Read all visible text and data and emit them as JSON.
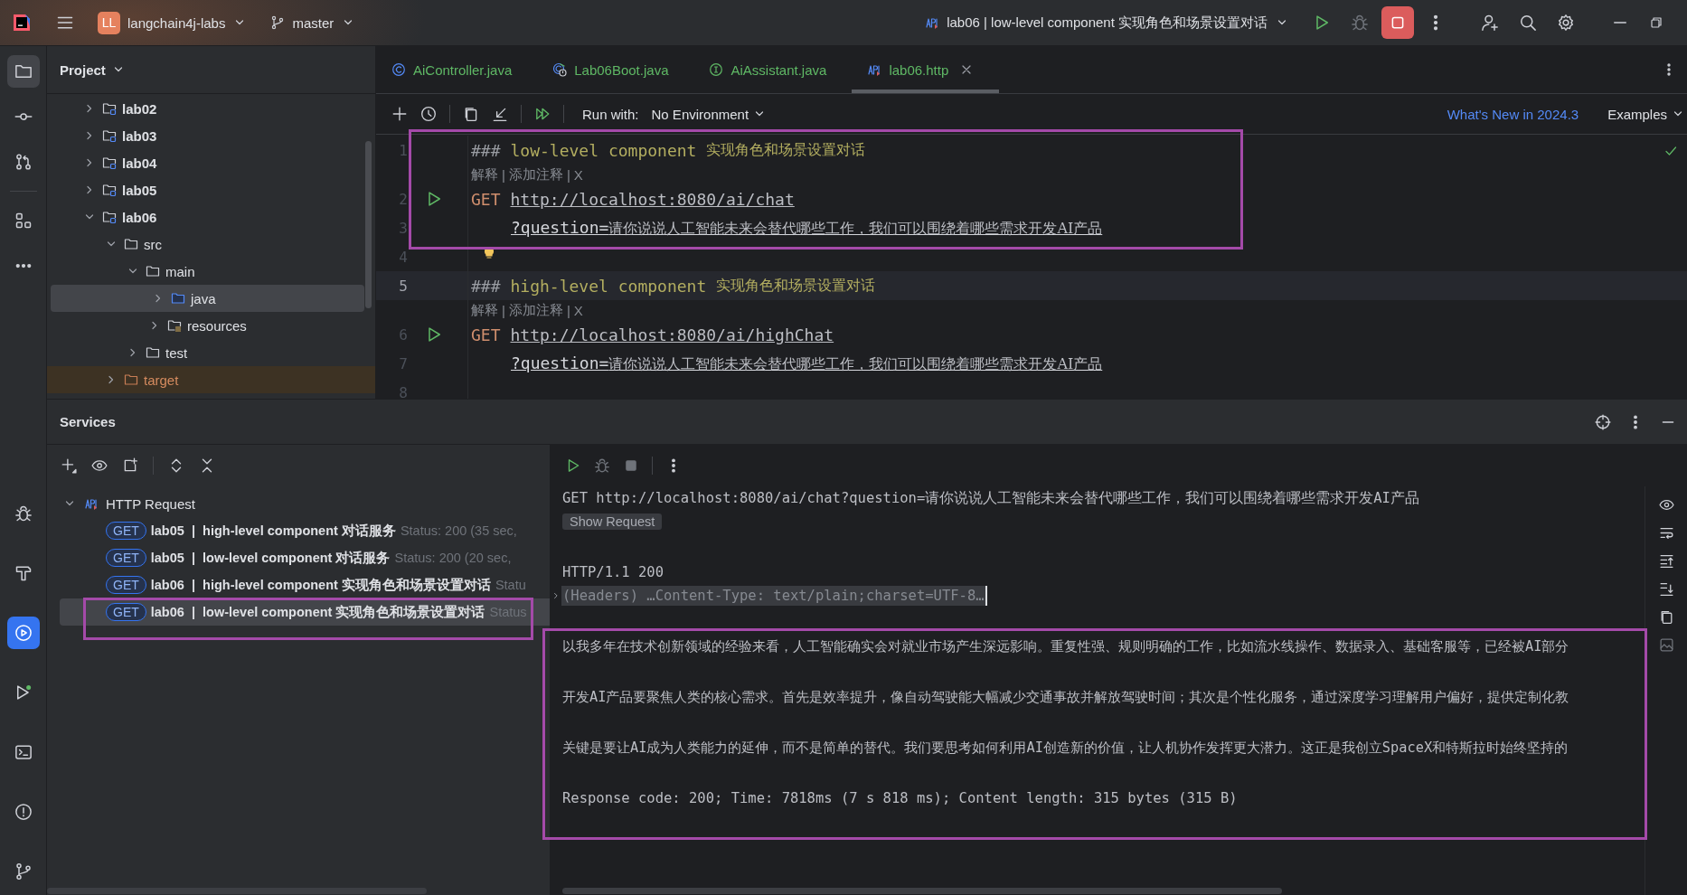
{
  "window": {
    "project_badge": "LL",
    "project": "langchain4j-labs",
    "branch": "master",
    "run_config": "lab06 | low-level component 实现角色和场景设置对话"
  },
  "project_panel": {
    "title": "Project",
    "tree": [
      {
        "label": "lab02",
        "kind": "module",
        "expanded": false,
        "selected": false
      },
      {
        "label": "lab03",
        "kind": "module",
        "expanded": false,
        "selected": false
      },
      {
        "label": "lab04",
        "kind": "module",
        "expanded": false,
        "selected": false
      },
      {
        "label": "lab05",
        "kind": "module",
        "expanded": false,
        "selected": false
      },
      {
        "label": "lab06",
        "kind": "module",
        "expanded": true,
        "selected": false,
        "children": [
          {
            "label": "src",
            "kind": "folder",
            "expanded": true,
            "selected": false,
            "children": [
              {
                "label": "main",
                "kind": "folder",
                "expanded": true,
                "selected": false,
                "children": [
                  {
                    "label": "java",
                    "kind": "source",
                    "expanded": false,
                    "selected": true
                  },
                  {
                    "label": "resources",
                    "kind": "resources",
                    "expanded": false,
                    "selected": false
                  }
                ]
              },
              {
                "label": "test",
                "kind": "folder",
                "expanded": false,
                "selected": false
              }
            ]
          },
          {
            "label": "target",
            "kind": "excluded",
            "expanded": false,
            "selected": false
          }
        ]
      }
    ]
  },
  "editor": {
    "tabs": [
      {
        "label": "AiController.java",
        "kind": "class",
        "selected": false,
        "closable": false
      },
      {
        "label": "Lab06Boot.java",
        "kind": "boot",
        "selected": false,
        "closable": false
      },
      {
        "label": "AiAssistant.java",
        "kind": "interface",
        "selected": false,
        "closable": false
      },
      {
        "label": "lab06.http",
        "kind": "http",
        "selected": true,
        "closable": true
      }
    ],
    "toolbar": {
      "run_with_label": "Run with:",
      "environment": "No Environment",
      "whats_new": "What's New in 2024.3",
      "examples": "Examples"
    },
    "lines": [
      {
        "number": "1",
        "kind": "heading",
        "current": false,
        "marker": "###",
        "text": "low-level component",
        "note": "实现角色和场景设置对话"
      },
      {
        "kind": "inlay",
        "items": [
          "解释",
          "添加注释",
          "X"
        ],
        "separator": "|"
      },
      {
        "number": "2",
        "kind": "request",
        "current": false,
        "method": "GET",
        "url": "http://localhost:8080/ai/chat"
      },
      {
        "number": "3",
        "kind": "param",
        "current": false,
        "name": "?question=",
        "value": "请你说说人工智能未来会替代哪些工作，我们可以围绕着哪些需求开发AI产品"
      },
      {
        "number": "4",
        "kind": "blank",
        "current": false,
        "bulb": true
      },
      {
        "number": "5",
        "kind": "heading",
        "current": true,
        "marker": "###",
        "text": "high-level component",
        "note": "实现角色和场景设置对话"
      },
      {
        "kind": "inlay",
        "items": [
          "解释",
          "添加注释",
          "X"
        ],
        "separator": "|"
      },
      {
        "number": "6",
        "kind": "request",
        "current": false,
        "method": "GET",
        "url": "http://localhost:8080/ai/highChat"
      },
      {
        "number": "7",
        "kind": "param",
        "current": false,
        "name": "?question=",
        "value": "请你说说人工智能未来会替代哪些工作，我们可以围绕着哪些需求开发AI产品"
      },
      {
        "number": "8",
        "kind": "blank",
        "current": false,
        "bulb": false
      }
    ]
  },
  "services": {
    "title": "Services",
    "root": {
      "label": "HTTP Request",
      "expanded": true,
      "children": [
        {
          "method": "GET",
          "name": "lab05  |  high-level component 对话服务",
          "status": "Status: 200 (35 sec,",
          "selected": false
        },
        {
          "method": "GET",
          "name": "lab05  |  low-level component 对话服务",
          "status": "Status: 200 (20 sec,",
          "selected": false
        },
        {
          "method": "GET",
          "name": "lab06  |  high-level component 实现角色和场景设置对话",
          "status": "Statu",
          "selected": false
        },
        {
          "method": "GET",
          "name": "lab06  |  low-level component 实现角色和场景设置对话",
          "status": "Status",
          "selected": true
        }
      ]
    },
    "output": {
      "request_line": "GET http://localhost:8080/ai/chat?question=请你说说人工智能未来会替代哪些工作，我们可以围绕着哪些需求开发AI产品",
      "show_request": "Show Request",
      "status_line": "HTTP/1.1 200",
      "headers": {
        "text": "(Headers) …Content-Type: text/plain;charset=UTF-8…",
        "expanded": false
      },
      "body": [
        "以我多年在技术创新领域的经验来看，人工智能确实会对就业市场产生深远影响。重复性强、规则明确的工作，比如流水线操作、数据录入、基础客服等，已经被AI部分",
        "开发AI产品要聚焦人类的核心需求。首先是效率提升，像自动驾驶能大幅减少交通事故并解放驾驶时间；其次是个性化服务，通过深度学习理解用户偏好，提供定制化教",
        "关键是要让AI成为人类能力的延伸，而不是简单的替代。我们要思考如何利用AI创造新的价值，让人机协作发挥更大潜力。这正是我创立SpaceX和特斯拉时始终坚持的"
      ],
      "summary": "Response code: 200; Time: 7818ms (7 s 818 ms); Content length: 315 bytes (315 B)"
    }
  }
}
